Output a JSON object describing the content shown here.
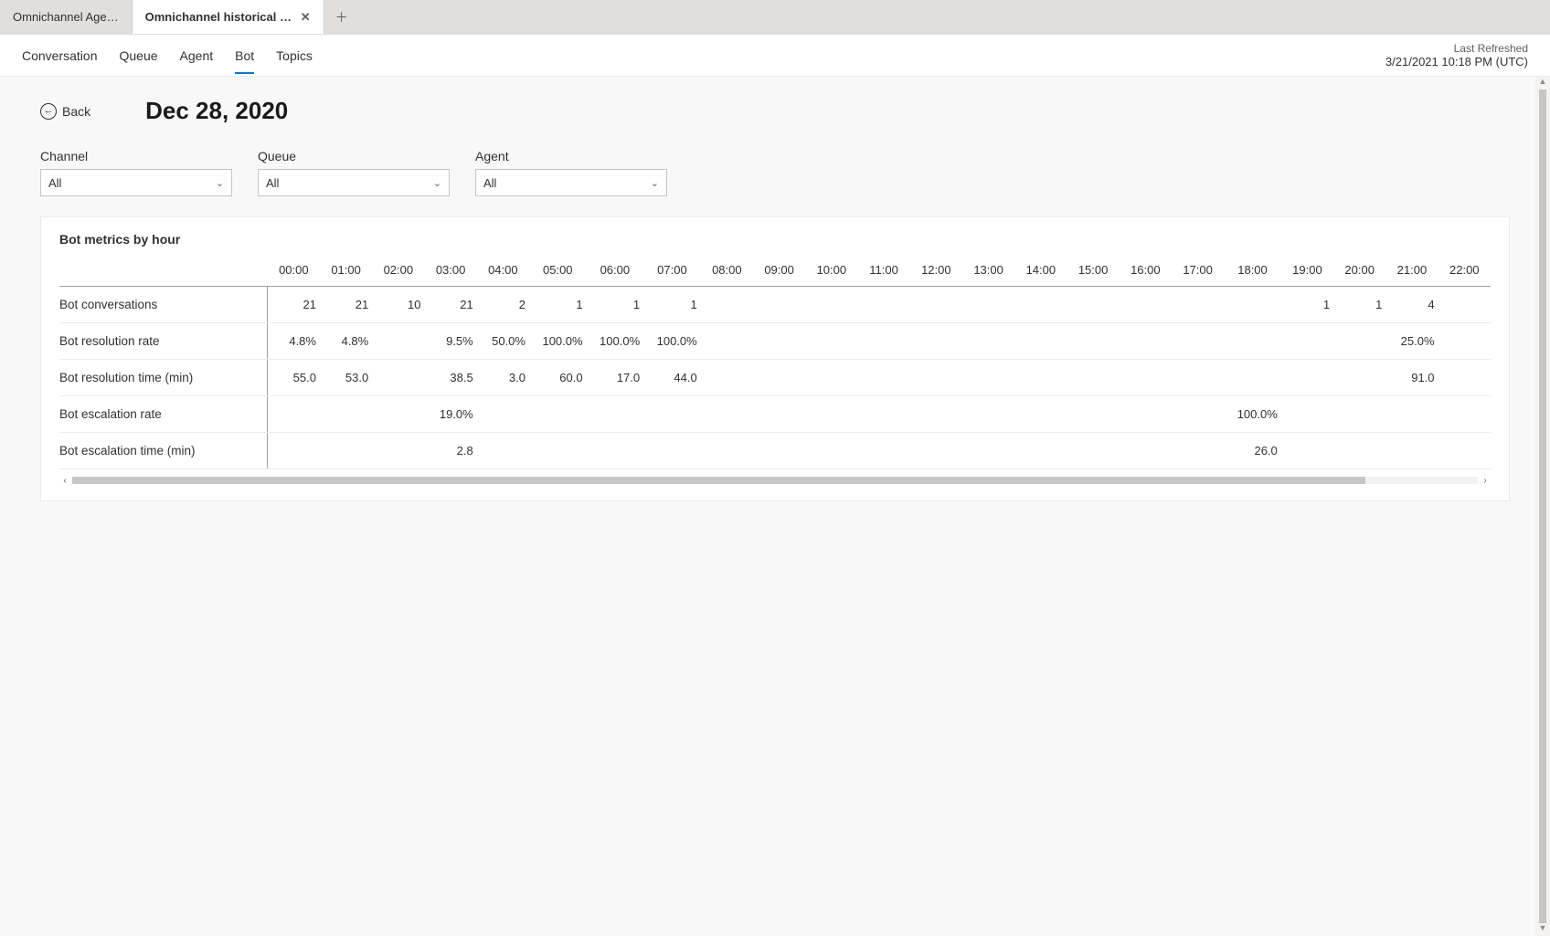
{
  "tabs": [
    {
      "label": "Omnichannel Age…",
      "active": false,
      "closeable": false
    },
    {
      "label": "Omnichannel historical an…",
      "active": true,
      "closeable": true
    }
  ],
  "nav": {
    "items": [
      {
        "label": "Conversation",
        "active": false
      },
      {
        "label": "Queue",
        "active": false
      },
      {
        "label": "Agent",
        "active": false
      },
      {
        "label": "Bot",
        "active": true
      },
      {
        "label": "Topics",
        "active": false
      }
    ],
    "refresh_label": "Last Refreshed",
    "refresh_time": "3/21/2021 10:18 PM (UTC)"
  },
  "header": {
    "back_label": "Back",
    "title": "Dec 28, 2020"
  },
  "filters": [
    {
      "label": "Channel",
      "value": "All"
    },
    {
      "label": "Queue",
      "value": "All"
    },
    {
      "label": "Agent",
      "value": "All"
    }
  ],
  "metrics": {
    "title": "Bot metrics by hour",
    "hours": [
      "00:00",
      "01:00",
      "02:00",
      "03:00",
      "04:00",
      "05:00",
      "06:00",
      "07:00",
      "08:00",
      "09:00",
      "10:00",
      "11:00",
      "12:00",
      "13:00",
      "14:00",
      "15:00",
      "16:00",
      "17:00",
      "18:00",
      "19:00",
      "20:00",
      "21:00",
      "22:00"
    ],
    "rows": [
      {
        "label": "Bot conversations",
        "values": [
          "21",
          "21",
          "10",
          "21",
          "2",
          "1",
          "1",
          "1",
          "",
          "",
          "",
          "",
          "",
          "",
          "",
          "",
          "",
          "",
          "",
          "1",
          "1",
          "4",
          ""
        ]
      },
      {
        "label": "Bot resolution rate",
        "values": [
          "4.8%",
          "4.8%",
          "",
          "9.5%",
          "50.0%",
          "100.0%",
          "100.0%",
          "100.0%",
          "",
          "",
          "",
          "",
          "",
          "",
          "",
          "",
          "",
          "",
          "",
          "",
          "",
          "25.0%",
          ""
        ]
      },
      {
        "label": "Bot resolution time (min)",
        "values": [
          "55.0",
          "53.0",
          "",
          "38.5",
          "3.0",
          "60.0",
          "17.0",
          "44.0",
          "",
          "",
          "",
          "",
          "",
          "",
          "",
          "",
          "",
          "",
          "",
          "",
          "",
          "91.0",
          ""
        ]
      },
      {
        "label": "Bot escalation rate",
        "values": [
          "",
          "",
          "",
          "19.0%",
          "",
          "",
          "",
          "",
          "",
          "",
          "",
          "",
          "",
          "",
          "",
          "",
          "",
          "",
          "100.0%",
          "",
          "",
          "",
          ""
        ]
      },
      {
        "label": "Bot escalation time (min)",
        "values": [
          "",
          "",
          "",
          "2.8",
          "",
          "",
          "",
          "",
          "",
          "",
          "",
          "",
          "",
          "",
          "",
          "",
          "",
          "",
          "26.0",
          "",
          "",
          "",
          ""
        ]
      }
    ]
  },
  "chart_data": {
    "type": "table",
    "title": "Bot metrics by hour",
    "categories": [
      "00:00",
      "01:00",
      "02:00",
      "03:00",
      "04:00",
      "05:00",
      "06:00",
      "07:00",
      "08:00",
      "09:00",
      "10:00",
      "11:00",
      "12:00",
      "13:00",
      "14:00",
      "15:00",
      "16:00",
      "17:00",
      "18:00",
      "19:00",
      "20:00",
      "21:00",
      "22:00"
    ],
    "series": [
      {
        "name": "Bot conversations",
        "values": [
          21,
          21,
          10,
          21,
          2,
          1,
          1,
          1,
          null,
          null,
          null,
          null,
          null,
          null,
          null,
          null,
          null,
          null,
          null,
          1,
          1,
          4,
          null
        ]
      },
      {
        "name": "Bot resolution rate (%)",
        "values": [
          4.8,
          4.8,
          null,
          9.5,
          50.0,
          100.0,
          100.0,
          100.0,
          null,
          null,
          null,
          null,
          null,
          null,
          null,
          null,
          null,
          null,
          null,
          null,
          null,
          25.0,
          null
        ]
      },
      {
        "name": "Bot resolution time (min)",
        "values": [
          55.0,
          53.0,
          null,
          38.5,
          3.0,
          60.0,
          17.0,
          44.0,
          null,
          null,
          null,
          null,
          null,
          null,
          null,
          null,
          null,
          null,
          null,
          null,
          null,
          91.0,
          null
        ]
      },
      {
        "name": "Bot escalation rate (%)",
        "values": [
          null,
          null,
          null,
          19.0,
          null,
          null,
          null,
          null,
          null,
          null,
          null,
          null,
          null,
          null,
          null,
          null,
          null,
          null,
          100.0,
          null,
          null,
          null,
          null
        ]
      },
      {
        "name": "Bot escalation time (min)",
        "values": [
          null,
          null,
          null,
          2.8,
          null,
          null,
          null,
          null,
          null,
          null,
          null,
          null,
          null,
          null,
          null,
          null,
          null,
          null,
          26.0,
          null,
          null,
          null,
          null
        ]
      }
    ]
  }
}
